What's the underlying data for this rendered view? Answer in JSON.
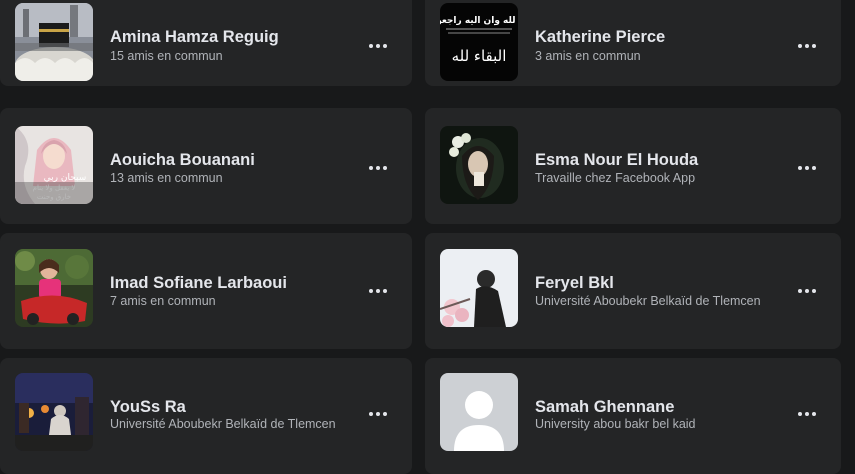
{
  "friends": [
    {
      "name": "Amina Hamza Reguig",
      "sub": "15 amis en commun",
      "avatar": "mosque-photo"
    },
    {
      "name": "Katherine Pierce",
      "sub": "3 amis en commun",
      "avatar": "arabic-text-image",
      "avatar_text_top": "ان لله وان اليه راجعون",
      "avatar_text_main": "البقاء لله"
    },
    {
      "name": "Aouicha Bouanani",
      "sub": "13 amis en commun",
      "avatar": "hijab-illustration",
      "avatar_text_1": "سبحان ربي",
      "avatar_text_2": "لا يغفل ولا ينام",
      "avatar_text_3": "خارق وحنت"
    },
    {
      "name": "Esma Nour El Houda",
      "sub": "Travaille chez Facebook App",
      "avatar": "flower-crown-photo"
    },
    {
      "name": "Imad Sofiane Larbaoui",
      "sub": "7 amis en commun",
      "avatar": "child-toy-car-photo"
    },
    {
      "name": "Feryel Bkl",
      "sub": "Université Aboubekr Belkaïd de Tlemcen",
      "avatar": "blossom-photo"
    },
    {
      "name": "YouSs Ra",
      "sub": "Université Aboubekr Belkaïd de Tlemcen",
      "avatar": "city-night-photo"
    },
    {
      "name": "Samah Ghennane",
      "sub": "University abou bakr bel kaid",
      "avatar": "default-profile-silhouette"
    }
  ],
  "more_button_label": "More options"
}
